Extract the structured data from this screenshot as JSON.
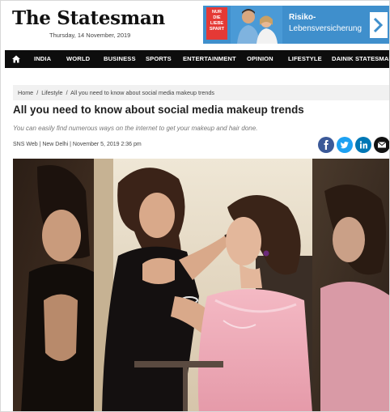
{
  "header": {
    "logo": "The Statesman",
    "date": "Thursday, 14 November, 2019"
  },
  "ad": {
    "badge_line1": "NUR DIE",
    "badge_line2": "LIEBE",
    "badge_line3": "SPART",
    "line1": "Risiko-",
    "line2": "Lebensversicherung",
    "colors": {
      "background": "#3f8fcc",
      "badge": "#e53935"
    }
  },
  "nav": {
    "home_icon": "home-icon",
    "items": [
      "INDIA",
      "WORLD",
      "BUSINESS",
      "SPORTS",
      "ENTERTAINMENT",
      "OPINION",
      "LIFESTYLE",
      "DAINIK STATESMAN"
    ]
  },
  "breadcrumb": {
    "items": [
      "Home",
      "Lifestyle",
      "All you need to know about social media makeup trends"
    ],
    "separator": "/"
  },
  "article": {
    "title": "All you need to know about social media makeup trends",
    "subtitle": "You can easily find numerous ways on the internet to get your makeup and hair done.",
    "byline": "SNS Web | New Delhi | November 5, 2019 2:36 pm"
  },
  "share": {
    "buttons": [
      {
        "icon": "facebook-icon",
        "color": "#3b5998"
      },
      {
        "icon": "twitter-icon",
        "color": "#1da1f2"
      },
      {
        "icon": "linkedin-icon",
        "color": "#0077b5"
      },
      {
        "icon": "email-icon",
        "color": "#111111"
      }
    ]
  }
}
